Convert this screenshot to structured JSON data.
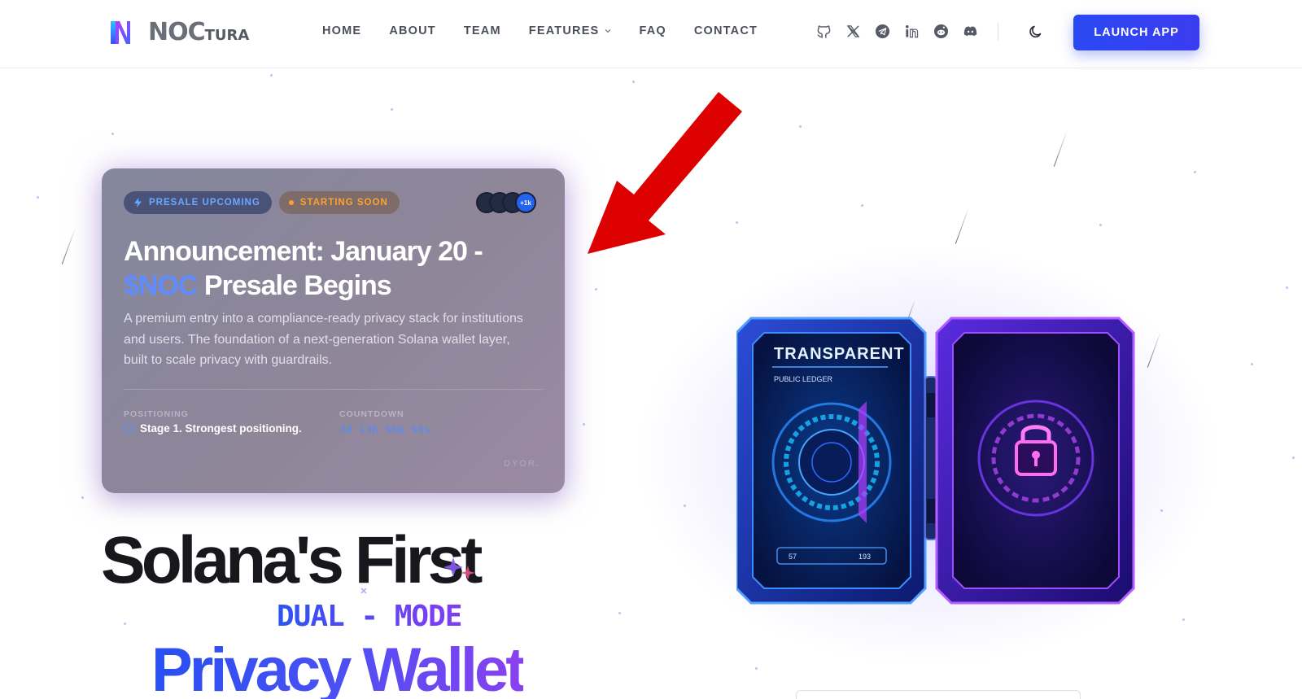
{
  "brand": {
    "logo_text": "NOC",
    "logo_text_small": "TURA"
  },
  "nav": {
    "home": "HOME",
    "about": "ABOUT",
    "team": "TEAM",
    "features": "FEATURES",
    "faq": "FAQ",
    "contact": "CONTACT"
  },
  "socials": [
    "github-icon",
    "x-icon",
    "telegram-icon",
    "linkedin-icon",
    "reddit-icon",
    "discord-icon"
  ],
  "theme_toggle_icon": "moon-icon",
  "launch_label": "LAUNCH APP",
  "announcement": {
    "badge_presale": "PRESALE UPCOMING",
    "badge_soon": "STARTING SOON",
    "avatar_count": "+1k",
    "title_part1": "Announcement: January 20 -",
    "title_token": "$NOC",
    "title_part2": "Presale Begins",
    "description": "A premium entry into a compliance-ready privacy stack for institutions and users. The foundation of a next-generation Solana wallet layer, built to scale privacy with guardrails.",
    "positioning_label": "POSITIONING",
    "positioning_value": "Stage 1. Strongest positioning.",
    "countdown_label": "COUNTDOWN",
    "countdown_value": "3d 13h 56m 50s",
    "dyor": "DYOR."
  },
  "hero": {
    "line1": "Solana's First",
    "line2": "DUAL - MODE",
    "line3": "Privacy Wallet"
  },
  "illustration": {
    "panel_title": "TRANSPARENT",
    "panel_subtitle": "PUBLIC LEDGER",
    "readout_left": "57",
    "readout_right": "193"
  },
  "colors": {
    "accent": "#2a49f3",
    "annotation_arrow": "#dd0000",
    "token_highlight": "#5f8cff",
    "countdown": "#4d8cff",
    "starting_soon": "#ffa033"
  }
}
